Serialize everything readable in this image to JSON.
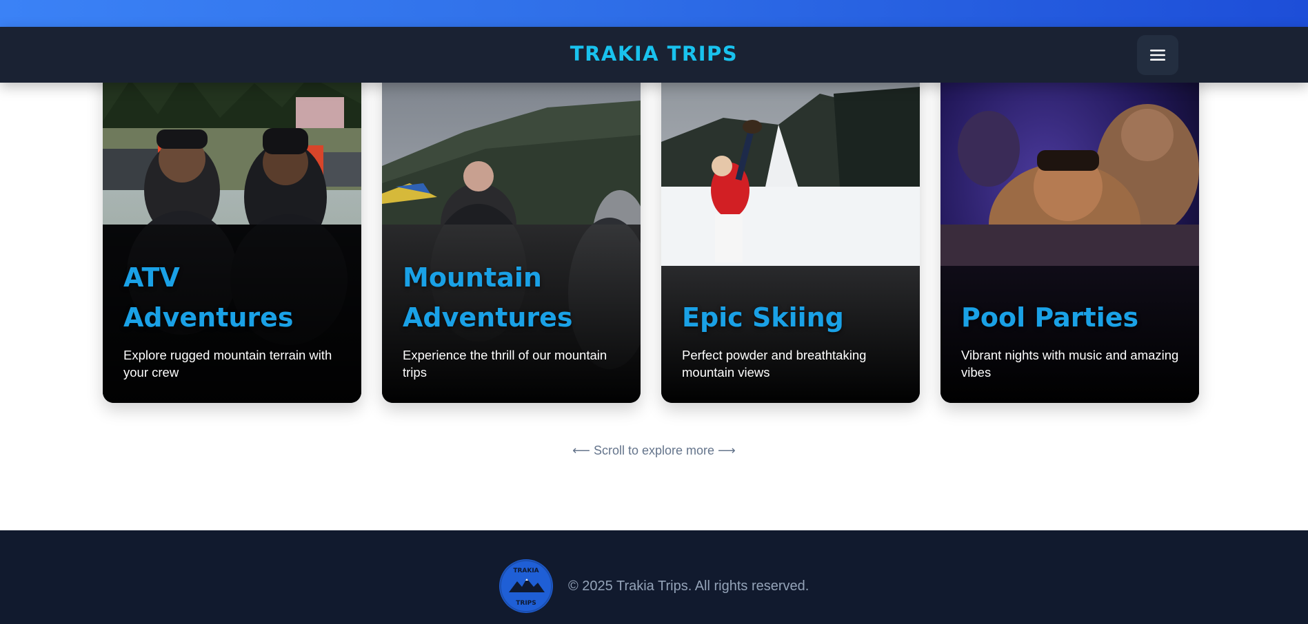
{
  "header": {
    "brand": "TRAKIA TRIPS",
    "menu_icon": "hamburger-menu-icon"
  },
  "cards": [
    {
      "title": "ATV Adventures",
      "description": "Explore rugged mountain terrain with your crew"
    },
    {
      "title": "Mountain Adventures",
      "description": "Experience the thrill of our mountain trips"
    },
    {
      "title": "Epic Skiing",
      "description": "Perfect powder and breathtaking mountain views"
    },
    {
      "title": "Pool Parties",
      "description": "Vibrant nights with music and amazing vibes"
    }
  ],
  "scroll_hint": "⟵ Scroll to explore more ⟶",
  "footer": {
    "logo_text": "TRAKIA TRIPS",
    "copyright": "© 2025 Trakia Trips. All rights reserved."
  },
  "colors": {
    "accent": "#1aa1e6",
    "brand": "#19c2ee",
    "navbar": "#1a2233",
    "footer": "#111a2e"
  }
}
